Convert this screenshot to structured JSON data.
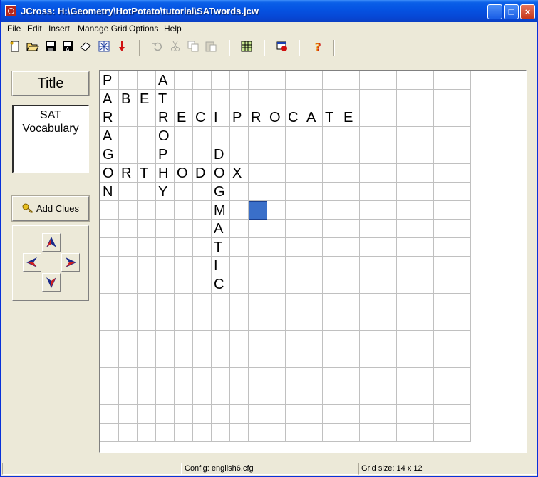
{
  "window": {
    "title": "JCross: H:\\Geometry\\HotPotato\\tutorial\\SATwords.jcw",
    "controls": {
      "minimize": "_",
      "maximize": "□",
      "close": "×"
    }
  },
  "menu": [
    "File",
    "Edit",
    "Insert",
    "Manage Grid",
    "Options",
    "Help"
  ],
  "toolbar": {
    "icons": [
      "new-file-icon",
      "open-folder-icon",
      "save-icon",
      "save-as-icon",
      "eraser-icon",
      "web-export-icon",
      "down-arrow-icon",
      "undo-icon",
      "cut-icon",
      "copy-icon",
      "paste-icon",
      "grid-icon",
      "export-window-icon",
      "help-icon"
    ]
  },
  "left_panel": {
    "title_button": "Title",
    "subtitle_lines": [
      "SAT",
      "Vocabulary"
    ],
    "add_clues": "Add Clues"
  },
  "grid": {
    "rows_drawn": 20,
    "cols_drawn": 20,
    "letters": [
      {
        "r": 0,
        "c": 0,
        "ch": "P"
      },
      {
        "r": 0,
        "c": 3,
        "ch": "A"
      },
      {
        "r": 1,
        "c": 0,
        "ch": "A"
      },
      {
        "r": 1,
        "c": 1,
        "ch": "B"
      },
      {
        "r": 1,
        "c": 2,
        "ch": "E"
      },
      {
        "r": 1,
        "c": 3,
        "ch": "T"
      },
      {
        "r": 2,
        "c": 0,
        "ch": "R"
      },
      {
        "r": 2,
        "c": 3,
        "ch": "R"
      },
      {
        "r": 2,
        "c": 4,
        "ch": "E"
      },
      {
        "r": 2,
        "c": 5,
        "ch": "C"
      },
      {
        "r": 2,
        "c": 6,
        "ch": "I"
      },
      {
        "r": 2,
        "c": 7,
        "ch": "P"
      },
      {
        "r": 2,
        "c": 8,
        "ch": "R"
      },
      {
        "r": 2,
        "c": 9,
        "ch": "O"
      },
      {
        "r": 2,
        "c": 10,
        "ch": "C"
      },
      {
        "r": 2,
        "c": 11,
        "ch": "A"
      },
      {
        "r": 2,
        "c": 12,
        "ch": "T"
      },
      {
        "r": 2,
        "c": 13,
        "ch": "E"
      },
      {
        "r": 3,
        "c": 0,
        "ch": "A"
      },
      {
        "r": 3,
        "c": 3,
        "ch": "O"
      },
      {
        "r": 4,
        "c": 0,
        "ch": "G"
      },
      {
        "r": 4,
        "c": 3,
        "ch": "P"
      },
      {
        "r": 4,
        "c": 6,
        "ch": "D"
      },
      {
        "r": 5,
        "c": 0,
        "ch": "O"
      },
      {
        "r": 5,
        "c": 1,
        "ch": "R"
      },
      {
        "r": 5,
        "c": 2,
        "ch": "T"
      },
      {
        "r": 5,
        "c": 3,
        "ch": "H"
      },
      {
        "r": 5,
        "c": 4,
        "ch": "O"
      },
      {
        "r": 5,
        "c": 5,
        "ch": "D"
      },
      {
        "r": 5,
        "c": 6,
        "ch": "O"
      },
      {
        "r": 5,
        "c": 7,
        "ch": "X"
      },
      {
        "r": 6,
        "c": 0,
        "ch": "N"
      },
      {
        "r": 6,
        "c": 3,
        "ch": "Y"
      },
      {
        "r": 6,
        "c": 6,
        "ch": "G"
      },
      {
        "r": 7,
        "c": 6,
        "ch": "M"
      },
      {
        "r": 8,
        "c": 6,
        "ch": "A"
      },
      {
        "r": 9,
        "c": 6,
        "ch": "T"
      },
      {
        "r": 10,
        "c": 6,
        "ch": "I"
      },
      {
        "r": 11,
        "c": 6,
        "ch": "C"
      }
    ],
    "selected": {
      "r": 7,
      "c": 8
    }
  },
  "status": {
    "config": "Config: english6.cfg",
    "grid_size": "Grid size: 14 x 12"
  }
}
